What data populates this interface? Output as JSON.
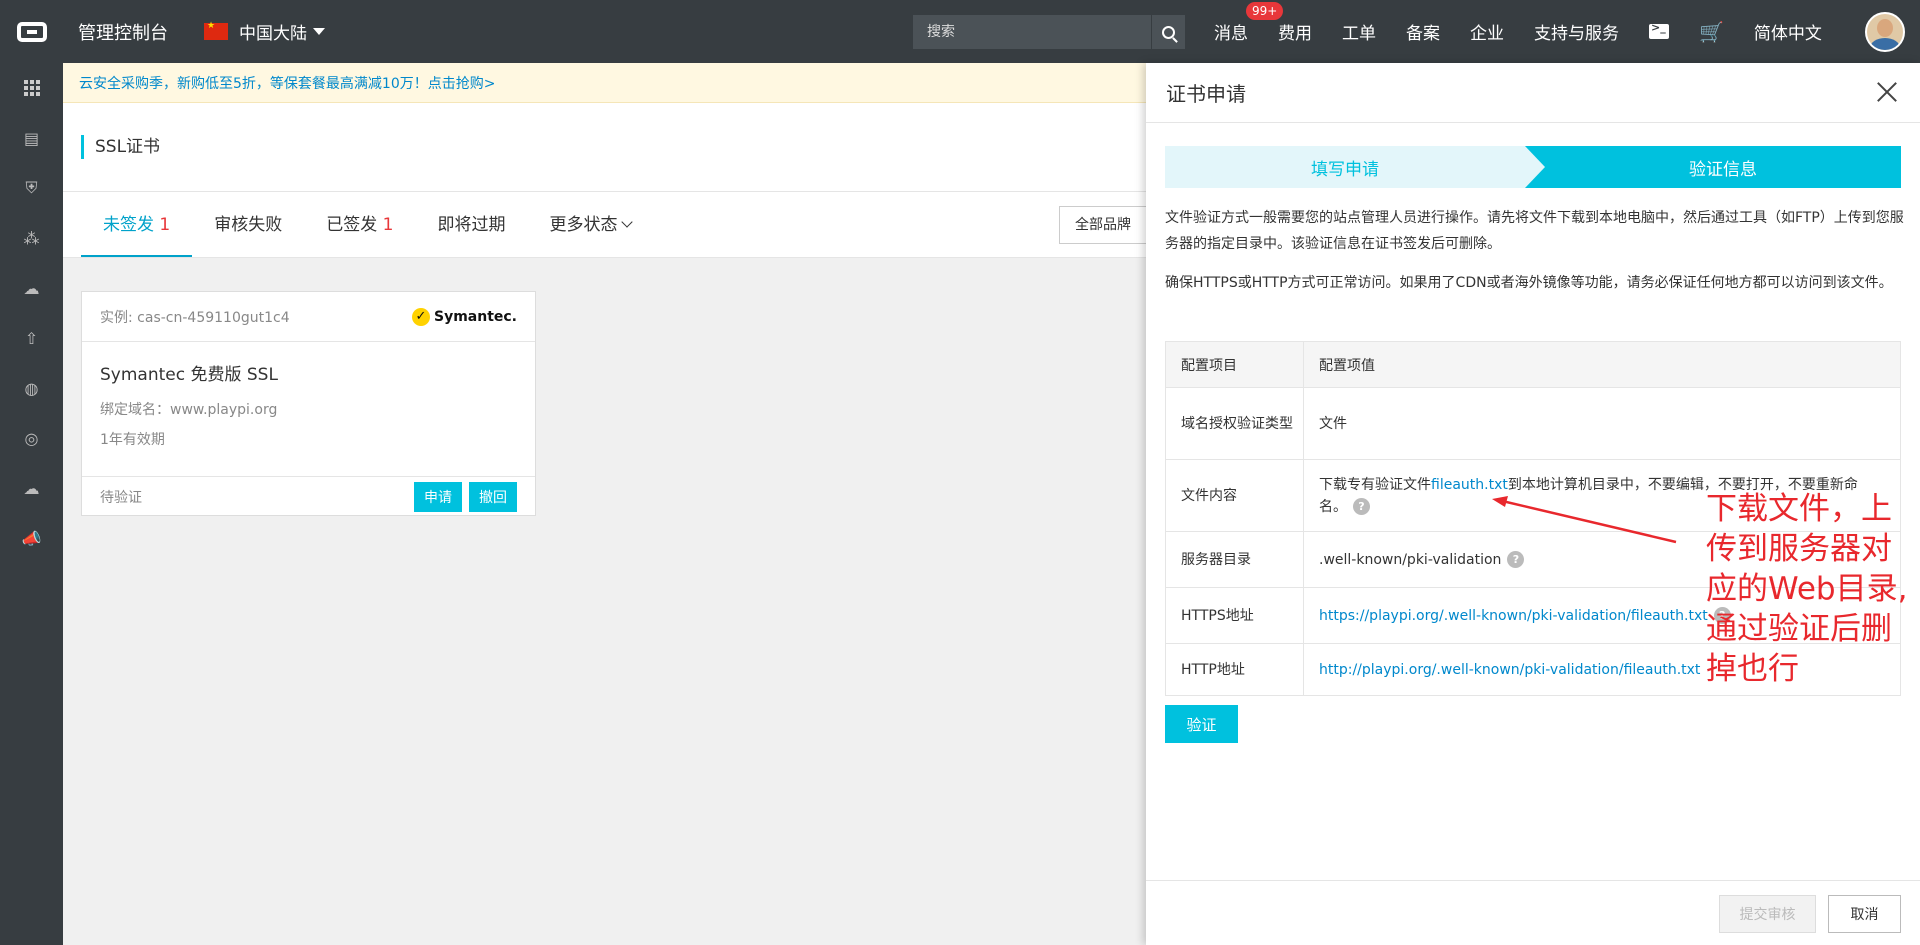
{
  "topbar": {
    "title": "管理控制台",
    "region": "中国大陆",
    "search_placeholder": "搜索",
    "nav": [
      "消息",
      "费用",
      "工单",
      "备案",
      "企业",
      "支持与服务"
    ],
    "badge": "99+",
    "language": "简体中文"
  },
  "sidebar": {
    "icons": [
      "grid-icon",
      "server-icon",
      "shield-icon",
      "network-icon",
      "cloud-icon",
      "arrow-cloud-icon",
      "globe-icon",
      "dns-icon",
      "cloud-drive-icon",
      "megaphone-icon"
    ]
  },
  "main": {
    "notice": "云安全采购季，新购低至5折，等保套餐最高满减10万！点击抢购>",
    "page_title": "SSL证书",
    "tabs": [
      {
        "label": "未签发",
        "count": "1"
      },
      {
        "label": "审核失败",
        "count": ""
      },
      {
        "label": "已签发",
        "count": "1"
      },
      {
        "label": "即将过期",
        "count": ""
      },
      {
        "label": "更多状态",
        "count": ""
      }
    ],
    "brand_select": "全部品牌",
    "card": {
      "instance": "实例: cas-cn-459110gut1c4",
      "brand": "Symantec.",
      "name": "Symantec 免费版 SSL",
      "domain": "绑定域名：www.playpi.org",
      "validity": "1年有效期",
      "status": "待验证",
      "apply_label": "申请",
      "revoke_label": "撤回"
    }
  },
  "drawer": {
    "title": "证书申请",
    "step1": "填写申请",
    "step2": "验证信息",
    "desc1": "文件验证方式一般需要您的站点管理人员进行操作。请先将文件下载到本地电脑中，然后通过工具（如FTP）上传到您服务器的指定目录中。该验证信息在证书签发后可删除。",
    "desc2": "确保HTTPS或HTTP方式可正常访问。如果用了CDN或者海外镜像等功能，请务必保证任何地方都可以访问到该文件。",
    "table": {
      "headers": [
        "配置项目",
        "配置项值"
      ],
      "rows": [
        {
          "key": "域名授权验证类型",
          "value": "文件"
        },
        {
          "key": "文件内容",
          "value_prefix": "下载专有验证文件",
          "value_link": "fileauth.txt",
          "value_suffix": "到本地计算机目录中，不要编辑，不要打开，不要重新命名。"
        },
        {
          "key": "服务器目录",
          "value": ".well-known/pki-validation"
        },
        {
          "key": "HTTPS地址",
          "value": "https://playpi.org/.well-known/pki-validation/fileauth.txt"
        },
        {
          "key": "HTTP地址",
          "value": "http://playpi.org/.well-known/pki-validation/fileauth.txt"
        }
      ]
    },
    "verify_label": "验证",
    "annotation": "下载文件，上传到服务器对应的Web目录,通过验证后删掉也行",
    "submit_label": "提交审核",
    "cancel_label": "取消"
  },
  "colors": {
    "topbar": "#373d41",
    "accent": "#00c1de",
    "link": "#0088cc",
    "danger": "#e8373a"
  }
}
